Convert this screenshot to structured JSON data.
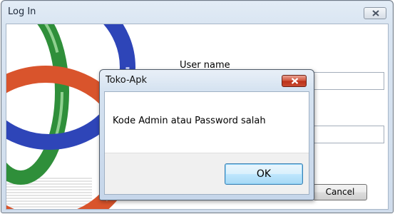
{
  "login_window": {
    "title": "Log In",
    "username_label": "User name",
    "cancel_label": "Cancel"
  },
  "dialog": {
    "title": "Toko-Apk",
    "message": "Kode Admin atau Password salah",
    "ok_label": "OK"
  }
}
